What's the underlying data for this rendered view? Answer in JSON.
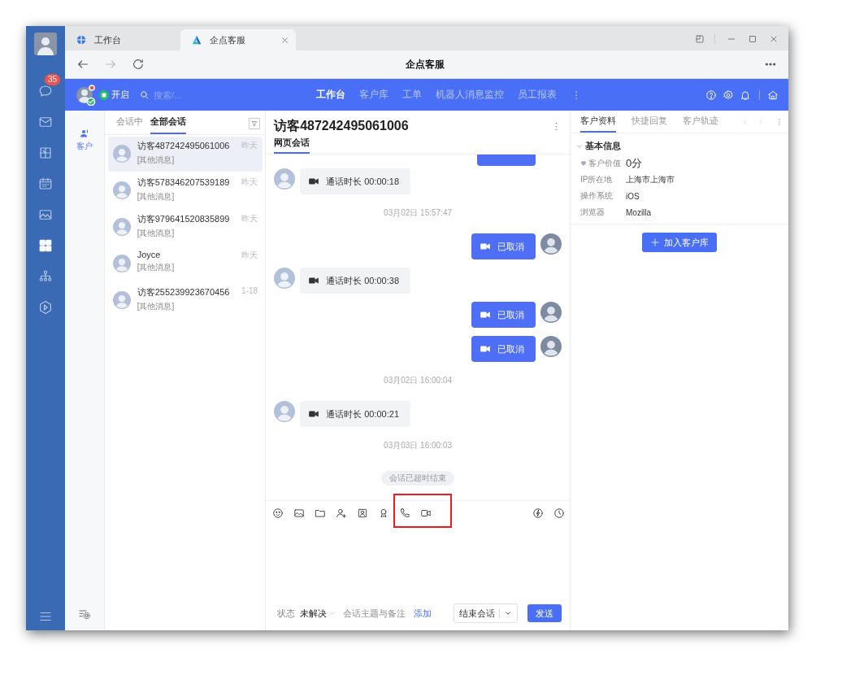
{
  "browser_tabs": [
    {
      "label": "工作台",
      "selected": false
    },
    {
      "label": "企点客服",
      "selected": true
    }
  ],
  "address_bar": {
    "title": "企点客服"
  },
  "rail": [
    {
      "kind": "chat",
      "badge": "35",
      "selected": false
    },
    {
      "kind": "mail",
      "selected": false
    },
    {
      "kind": "cube",
      "selected": false
    },
    {
      "kind": "calendar",
      "selected": false
    },
    {
      "kind": "image",
      "selected": false
    },
    {
      "kind": "grid",
      "selected": true
    },
    {
      "kind": "org",
      "selected": false
    },
    {
      "kind": "hexagon",
      "selected": false
    }
  ],
  "header": {
    "status": "开启",
    "search_placeholder": "搜索/...",
    "nav": [
      {
        "label": "工作台",
        "selected": true
      },
      {
        "label": "客户库",
        "selected": false
      },
      {
        "label": "工单",
        "selected": false
      },
      {
        "label": "机器人消息监控",
        "selected": false
      },
      {
        "label": "员工报表",
        "selected": false
      }
    ]
  },
  "side_nav": {
    "label": "客户",
    "selected": true
  },
  "conversation_list": {
    "tabs": [
      {
        "label": "会话中",
        "selected": false
      },
      {
        "label": "全部会话",
        "selected": true
      }
    ],
    "items": [
      {
        "name": "访客487242495061006",
        "preview": "[其他消息]",
        "time": "昨天",
        "selected": true
      },
      {
        "name": "访客578346207539189",
        "preview": "[其他消息]",
        "time": "昨天",
        "selected": false
      },
      {
        "name": "访客979641520835899",
        "preview": "[其他消息]",
        "time": "昨天",
        "selected": false
      },
      {
        "name": "Joyce",
        "preview": "[其他消息]",
        "time": "昨天",
        "selected": false
      },
      {
        "name": "访客255239923670456",
        "preview": "[其他消息]",
        "time": "1-18",
        "selected": false
      }
    ]
  },
  "chat": {
    "title": "访客487242495061006",
    "tabs": [
      {
        "label": "网页会话",
        "selected": true
      }
    ],
    "messages": [
      {
        "kind": "partial"
      },
      {
        "kind": "in",
        "text": "通话时长 00:00:18"
      },
      {
        "kind": "time",
        "text": "03月02日 15:57:47"
      },
      {
        "kind": "out",
        "text": "已取消"
      },
      {
        "kind": "in",
        "text": "通话时长 00:00:38"
      },
      {
        "kind": "out",
        "text": "已取消"
      },
      {
        "kind": "out",
        "text": "已取消"
      },
      {
        "kind": "time",
        "text": "03月02日 16:00:04"
      },
      {
        "kind": "in",
        "text": "通话时长 00:00:21"
      },
      {
        "kind": "time",
        "text": "03月03日 16:00:03"
      },
      {
        "kind": "notice",
        "text": "会话已超时结束"
      }
    ],
    "status_label": "状态",
    "status_value": "未解决",
    "topic_label": "会话主题与备注",
    "add_link": "添加",
    "end_button": "结束会话",
    "send_button": "发送"
  },
  "customer_panel": {
    "tabs": [
      {
        "label": "客户资料",
        "selected": true
      },
      {
        "label": "快捷回复",
        "selected": false
      },
      {
        "label": "客户轨迹",
        "selected": false
      }
    ],
    "section": "基本信息",
    "expanded": true,
    "fields": [
      {
        "kind": "score",
        "label": "客户价值",
        "value": "0分"
      },
      {
        "kind": "plain",
        "label": "IP所在地",
        "value": "上海市上海市"
      },
      {
        "kind": "plain",
        "label": "操作系统",
        "value": "iOS"
      },
      {
        "kind": "plain",
        "label": "浏览器",
        "value": "Mozilla"
      }
    ],
    "add_button": "加入客户库"
  }
}
